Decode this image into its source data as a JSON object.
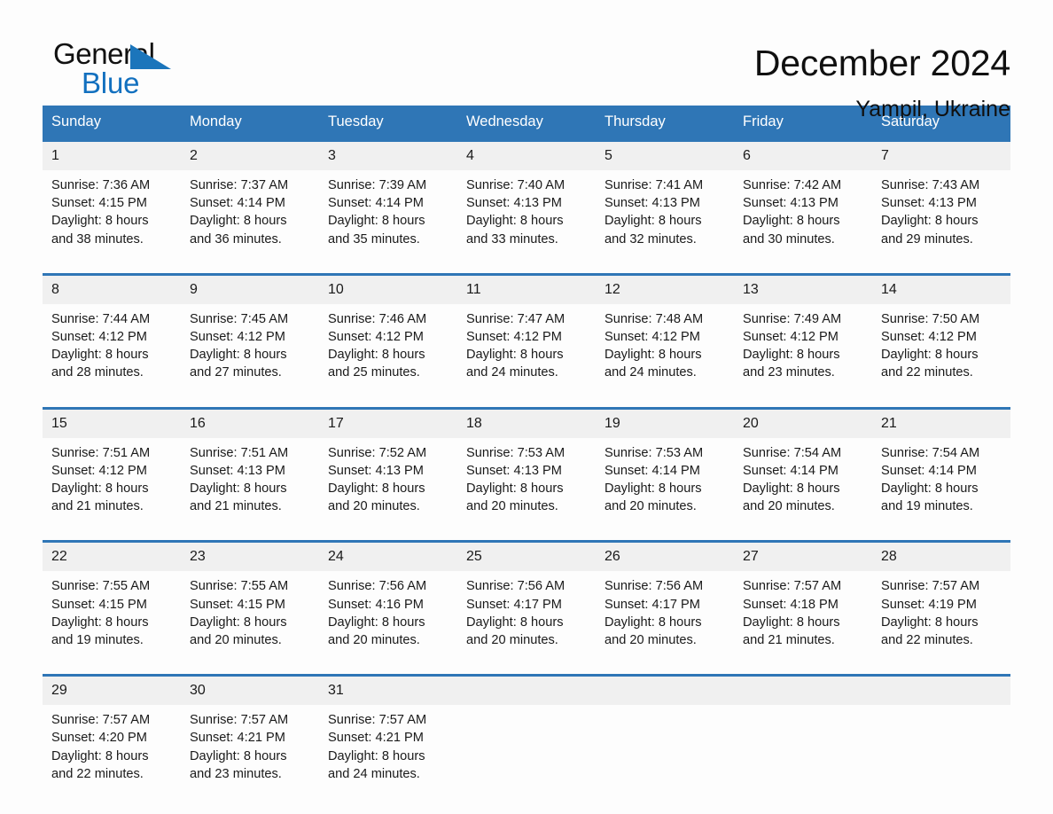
{
  "brand": {
    "name_top": "General",
    "name_bottom": "Blue",
    "accent_color": "#1b75bb"
  },
  "header": {
    "title": "December 2024",
    "location": "Yampil, Ukraine"
  },
  "calendar": {
    "header_color": "#2f76b6",
    "daynum_bg": "#f0f0f0",
    "weekday_headers": [
      "Sunday",
      "Monday",
      "Tuesday",
      "Wednesday",
      "Thursday",
      "Friday",
      "Saturday"
    ],
    "weeks": [
      {
        "days": [
          {
            "num": "1",
            "sunrise": "Sunrise: 7:36 AM",
            "sunset": "Sunset: 4:15 PM",
            "daylight_1": "Daylight: 8 hours",
            "daylight_2": "and 38 minutes."
          },
          {
            "num": "2",
            "sunrise": "Sunrise: 7:37 AM",
            "sunset": "Sunset: 4:14 PM",
            "daylight_1": "Daylight: 8 hours",
            "daylight_2": "and 36 minutes."
          },
          {
            "num": "3",
            "sunrise": "Sunrise: 7:39 AM",
            "sunset": "Sunset: 4:14 PM",
            "daylight_1": "Daylight: 8 hours",
            "daylight_2": "and 35 minutes."
          },
          {
            "num": "4",
            "sunrise": "Sunrise: 7:40 AM",
            "sunset": "Sunset: 4:13 PM",
            "daylight_1": "Daylight: 8 hours",
            "daylight_2": "and 33 minutes."
          },
          {
            "num": "5",
            "sunrise": "Sunrise: 7:41 AM",
            "sunset": "Sunset: 4:13 PM",
            "daylight_1": "Daylight: 8 hours",
            "daylight_2": "and 32 minutes."
          },
          {
            "num": "6",
            "sunrise": "Sunrise: 7:42 AM",
            "sunset": "Sunset: 4:13 PM",
            "daylight_1": "Daylight: 8 hours",
            "daylight_2": "and 30 minutes."
          },
          {
            "num": "7",
            "sunrise": "Sunrise: 7:43 AM",
            "sunset": "Sunset: 4:13 PM",
            "daylight_1": "Daylight: 8 hours",
            "daylight_2": "and 29 minutes."
          }
        ]
      },
      {
        "days": [
          {
            "num": "8",
            "sunrise": "Sunrise: 7:44 AM",
            "sunset": "Sunset: 4:12 PM",
            "daylight_1": "Daylight: 8 hours",
            "daylight_2": "and 28 minutes."
          },
          {
            "num": "9",
            "sunrise": "Sunrise: 7:45 AM",
            "sunset": "Sunset: 4:12 PM",
            "daylight_1": "Daylight: 8 hours",
            "daylight_2": "and 27 minutes."
          },
          {
            "num": "10",
            "sunrise": "Sunrise: 7:46 AM",
            "sunset": "Sunset: 4:12 PM",
            "daylight_1": "Daylight: 8 hours",
            "daylight_2": "and 25 minutes."
          },
          {
            "num": "11",
            "sunrise": "Sunrise: 7:47 AM",
            "sunset": "Sunset: 4:12 PM",
            "daylight_1": "Daylight: 8 hours",
            "daylight_2": "and 24 minutes."
          },
          {
            "num": "12",
            "sunrise": "Sunrise: 7:48 AM",
            "sunset": "Sunset: 4:12 PM",
            "daylight_1": "Daylight: 8 hours",
            "daylight_2": "and 24 minutes."
          },
          {
            "num": "13",
            "sunrise": "Sunrise: 7:49 AM",
            "sunset": "Sunset: 4:12 PM",
            "daylight_1": "Daylight: 8 hours",
            "daylight_2": "and 23 minutes."
          },
          {
            "num": "14",
            "sunrise": "Sunrise: 7:50 AM",
            "sunset": "Sunset: 4:12 PM",
            "daylight_1": "Daylight: 8 hours",
            "daylight_2": "and 22 minutes."
          }
        ]
      },
      {
        "days": [
          {
            "num": "15",
            "sunrise": "Sunrise: 7:51 AM",
            "sunset": "Sunset: 4:12 PM",
            "daylight_1": "Daylight: 8 hours",
            "daylight_2": "and 21 minutes."
          },
          {
            "num": "16",
            "sunrise": "Sunrise: 7:51 AM",
            "sunset": "Sunset: 4:13 PM",
            "daylight_1": "Daylight: 8 hours",
            "daylight_2": "and 21 minutes."
          },
          {
            "num": "17",
            "sunrise": "Sunrise: 7:52 AM",
            "sunset": "Sunset: 4:13 PM",
            "daylight_1": "Daylight: 8 hours",
            "daylight_2": "and 20 minutes."
          },
          {
            "num": "18",
            "sunrise": "Sunrise: 7:53 AM",
            "sunset": "Sunset: 4:13 PM",
            "daylight_1": "Daylight: 8 hours",
            "daylight_2": "and 20 minutes."
          },
          {
            "num": "19",
            "sunrise": "Sunrise: 7:53 AM",
            "sunset": "Sunset: 4:14 PM",
            "daylight_1": "Daylight: 8 hours",
            "daylight_2": "and 20 minutes."
          },
          {
            "num": "20",
            "sunrise": "Sunrise: 7:54 AM",
            "sunset": "Sunset: 4:14 PM",
            "daylight_1": "Daylight: 8 hours",
            "daylight_2": "and 20 minutes."
          },
          {
            "num": "21",
            "sunrise": "Sunrise: 7:54 AM",
            "sunset": "Sunset: 4:14 PM",
            "daylight_1": "Daylight: 8 hours",
            "daylight_2": "and 19 minutes."
          }
        ]
      },
      {
        "days": [
          {
            "num": "22",
            "sunrise": "Sunrise: 7:55 AM",
            "sunset": "Sunset: 4:15 PM",
            "daylight_1": "Daylight: 8 hours",
            "daylight_2": "and 19 minutes."
          },
          {
            "num": "23",
            "sunrise": "Sunrise: 7:55 AM",
            "sunset": "Sunset: 4:15 PM",
            "daylight_1": "Daylight: 8 hours",
            "daylight_2": "and 20 minutes."
          },
          {
            "num": "24",
            "sunrise": "Sunrise: 7:56 AM",
            "sunset": "Sunset: 4:16 PM",
            "daylight_1": "Daylight: 8 hours",
            "daylight_2": "and 20 minutes."
          },
          {
            "num": "25",
            "sunrise": "Sunrise: 7:56 AM",
            "sunset": "Sunset: 4:17 PM",
            "daylight_1": "Daylight: 8 hours",
            "daylight_2": "and 20 minutes."
          },
          {
            "num": "26",
            "sunrise": "Sunrise: 7:56 AM",
            "sunset": "Sunset: 4:17 PM",
            "daylight_1": "Daylight: 8 hours",
            "daylight_2": "and 20 minutes."
          },
          {
            "num": "27",
            "sunrise": "Sunrise: 7:57 AM",
            "sunset": "Sunset: 4:18 PM",
            "daylight_1": "Daylight: 8 hours",
            "daylight_2": "and 21 minutes."
          },
          {
            "num": "28",
            "sunrise": "Sunrise: 7:57 AM",
            "sunset": "Sunset: 4:19 PM",
            "daylight_1": "Daylight: 8 hours",
            "daylight_2": "and 22 minutes."
          }
        ]
      },
      {
        "days": [
          {
            "num": "29",
            "sunrise": "Sunrise: 7:57 AM",
            "sunset": "Sunset: 4:20 PM",
            "daylight_1": "Daylight: 8 hours",
            "daylight_2": "and 22 minutes."
          },
          {
            "num": "30",
            "sunrise": "Sunrise: 7:57 AM",
            "sunset": "Sunset: 4:21 PM",
            "daylight_1": "Daylight: 8 hours",
            "daylight_2": "and 23 minutes."
          },
          {
            "num": "31",
            "sunrise": "Sunrise: 7:57 AM",
            "sunset": "Sunset: 4:21 PM",
            "daylight_1": "Daylight: 8 hours",
            "daylight_2": "and 24 minutes."
          },
          {
            "num": "",
            "sunrise": "",
            "sunset": "",
            "daylight_1": "",
            "daylight_2": ""
          },
          {
            "num": "",
            "sunrise": "",
            "sunset": "",
            "daylight_1": "",
            "daylight_2": ""
          },
          {
            "num": "",
            "sunrise": "",
            "sunset": "",
            "daylight_1": "",
            "daylight_2": ""
          },
          {
            "num": "",
            "sunrise": "",
            "sunset": "",
            "daylight_1": "",
            "daylight_2": ""
          }
        ]
      }
    ]
  }
}
